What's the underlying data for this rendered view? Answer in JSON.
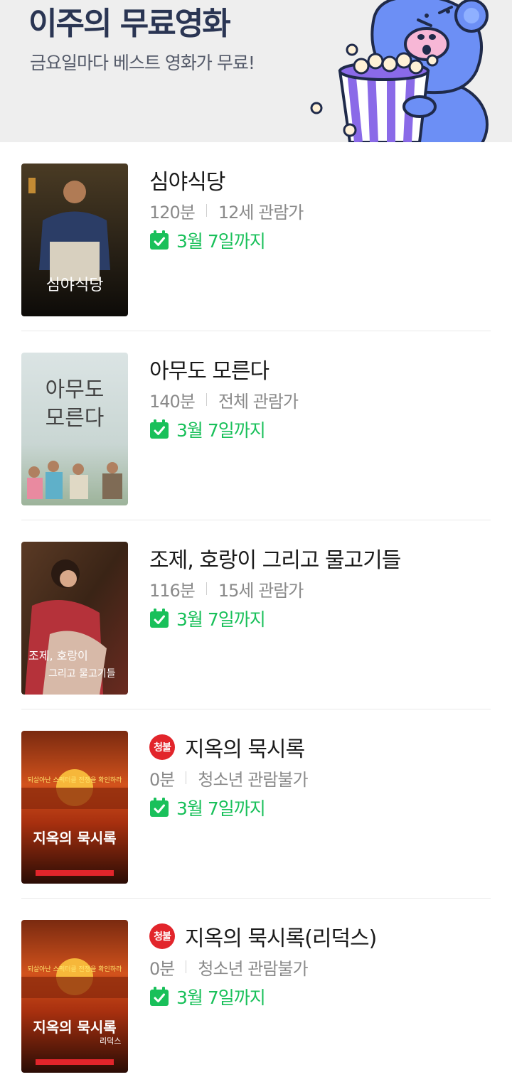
{
  "banner": {
    "title": "이주의 무료영화",
    "subtitle": "금요일마다 베스트 영화가 무료!"
  },
  "colors": {
    "banner_bg": "#eeeeee",
    "title": "#2a3553",
    "deadline_green": "#19c05a",
    "restricted_badge": "#e2252b",
    "mascot_blue": "#6c8ff5"
  },
  "movies": [
    {
      "title": "심야식당",
      "runtime": "120분",
      "rating": "12세 관람가",
      "deadline": "3월 7일까지",
      "badge": "",
      "poster_text": "심야식당",
      "poster_sub": ""
    },
    {
      "title": "아무도 모른다",
      "runtime": "140분",
      "rating": "전체 관람가",
      "deadline": "3월 7일까지",
      "badge": "",
      "poster_text": "아무도",
      "poster_sub": "모른다"
    },
    {
      "title": "조제, 호랑이 그리고 물고기들",
      "runtime": "116분",
      "rating": "15세 관람가",
      "deadline": "3월 7일까지",
      "badge": "",
      "poster_text": "조제, 호랑이",
      "poster_sub": "그리고 물고기들"
    },
    {
      "title": "지옥의 묵시록",
      "runtime": "0분",
      "rating": "청소년 관람불가",
      "deadline": "3월 7일까지",
      "badge": "청불",
      "poster_text": "지옥의 묵시록",
      "poster_sub": "되살아난 스펙터클 전쟁을 확인하라"
    },
    {
      "title": "지옥의 묵시록(리덕스)",
      "runtime": "0분",
      "rating": "청소년 관람불가",
      "deadline": "3월 7일까지",
      "badge": "청불",
      "poster_text": "지옥의 묵시록",
      "poster_sub": "되살아난 스펙터클 전쟁을 확인하라",
      "poster_extra": "리덕스"
    }
  ]
}
